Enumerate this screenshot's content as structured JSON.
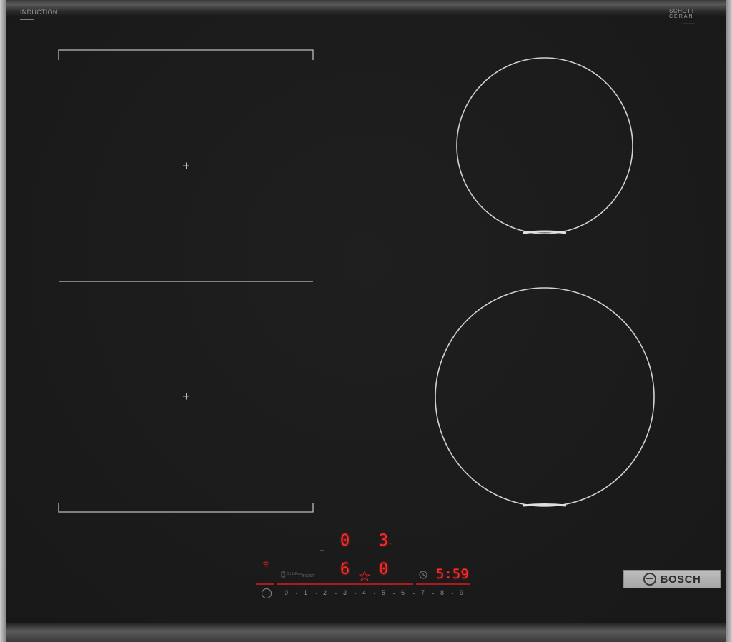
{
  "branding": {
    "top_left_title": "INDUCTION",
    "top_right_line1": "SCHOTT",
    "top_right_line2": "CERAN",
    "bottom_right_logo_text": "BOSCH"
  },
  "controls": {
    "displays": {
      "top_left_zone_level": "0",
      "top_right_zone_level": "3",
      "bottom_left_zone_level": "6",
      "bottom_right_zone_level": "0",
      "timer": "5:59"
    },
    "labels": {
      "combi_label": "Cmb Func",
      "boost_label": "BOOST"
    },
    "scale": [
      "0",
      "1",
      "2",
      "3",
      "4",
      "5",
      "6",
      "7",
      "8",
      "9"
    ]
  },
  "colors": {
    "led_red": "#ff2a2a",
    "glass_black": "#1b1b1b",
    "zone_outline": "#cfcfcf"
  },
  "icons": [
    "power-icon",
    "wifi-icon",
    "star-icon",
    "clock-icon",
    "bosch-logo-icon"
  ]
}
